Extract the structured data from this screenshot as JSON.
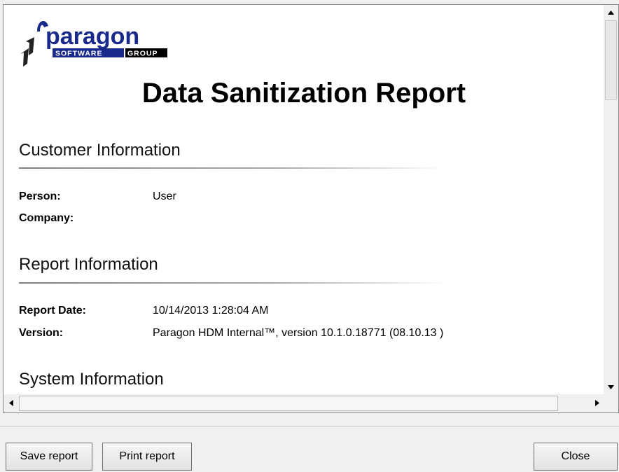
{
  "logo": {
    "name": "paragon",
    "sub_left": "SOFTWARE",
    "sub_right": "GROUP"
  },
  "report": {
    "title": "Data Sanitization Report"
  },
  "sections": {
    "customer": {
      "heading": "Customer Information",
      "person_label": "Person:",
      "person_value": "User",
      "company_label": "Company:",
      "company_value": ""
    },
    "report_info": {
      "heading": "Report Information",
      "date_label": "Report Date:",
      "date_value": "10/14/2013 1:28:04 AM",
      "version_label": "Version:",
      "version_value": "Paragon HDM Internal™, version 10.1.0.18771 (08.10.13 )"
    },
    "system": {
      "heading": "System Information"
    }
  },
  "buttons": {
    "save": "Save report",
    "print": "Print report",
    "close": "Close"
  },
  "icons": {
    "scroll_up": "triangle-up-icon",
    "scroll_down": "triangle-down-icon",
    "scroll_left": "triangle-left-icon",
    "scroll_right": "triangle-right-icon"
  },
  "colors": {
    "logo_blue": "#1a2a8a",
    "logo_dark": "#222222"
  }
}
